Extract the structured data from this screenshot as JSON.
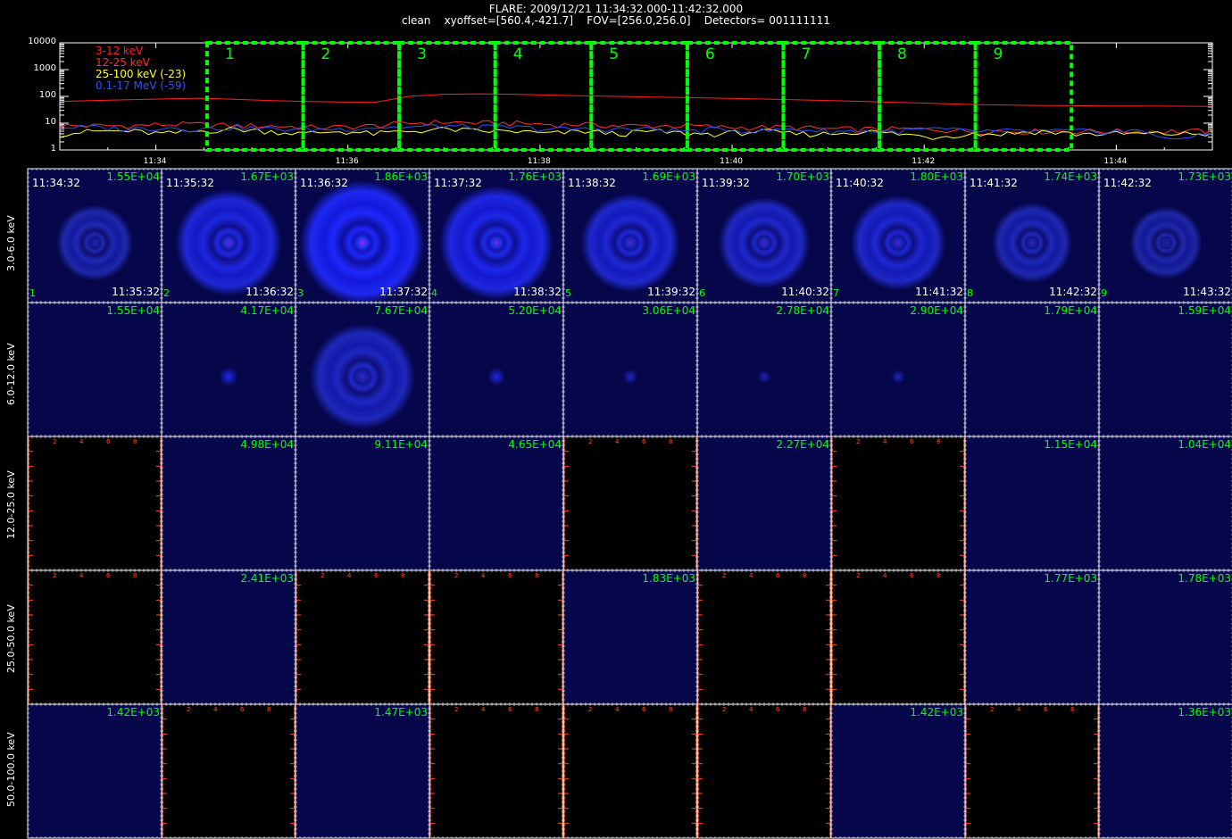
{
  "header": {
    "title_line1": "FLARE: 2009/12/21 11:34:32.000-11:42:32.000",
    "title_line2": "clean    xyoffset=[560.4,-421.7]    FOV=[256.0,256.0]    Detectors= 001111111"
  },
  "chart_data": [
    {
      "type": "line",
      "title": "",
      "yscale": "log",
      "ylim": [
        1,
        10000
      ],
      "y_tick_labels": [
        "1",
        "10",
        "100",
        "1000",
        "10000"
      ],
      "x_tick_labels": [
        "11:34",
        "11:36",
        "11:38",
        "11:40",
        "11:42",
        "11:44"
      ],
      "x_range": [
        "11:33",
        "11:45"
      ],
      "legend_placement": "top-left",
      "series": [
        {
          "name": "3-12 keV",
          "color": "#ff2020",
          "level_desc": "~60-120",
          "values": [
            65,
            70,
            75,
            80,
            85,
            78,
            70,
            65,
            62,
            60,
            100,
            120,
            125,
            120,
            112,
            105,
            100,
            95,
            90,
            85,
            80,
            75,
            70,
            65,
            60,
            55,
            50,
            48,
            46,
            45,
            44,
            44,
            43,
            42
          ]
        },
        {
          "name": "12-25 keV",
          "color": "#ff3030",
          "values": [
            8,
            8,
            8,
            9,
            9,
            8,
            8,
            7,
            7,
            8,
            10,
            11,
            10,
            10,
            9,
            9,
            8,
            8,
            8,
            7,
            7,
            7,
            6,
            6,
            6,
            6,
            5,
            5,
            5,
            5,
            5,
            5,
            5,
            5
          ]
        },
        {
          "name": "25-100 keV (-23)",
          "color": "#ffff30",
          "values": [
            4,
            5,
            5,
            4,
            5,
            6,
            5,
            4,
            5,
            4,
            5,
            6,
            5,
            5,
            4,
            5,
            4,
            5,
            4,
            4,
            5,
            4,
            4,
            5,
            4,
            3,
            4,
            4,
            5,
            4,
            4,
            4,
            4,
            4
          ]
        },
        {
          "name": "0.1-17 MeV (-59)",
          "color": "#3050ff",
          "values": [
            7,
            7,
            6,
            7,
            6,
            7,
            6,
            6,
            6,
            7,
            7,
            8,
            7,
            7,
            6,
            6,
            6,
            6,
            5,
            6,
            5,
            6,
            5,
            5,
            5,
            6,
            5,
            5,
            5,
            5,
            5,
            5,
            2,
            5
          ]
        }
      ],
      "interval_boxes": [
        "1",
        "2",
        "3",
        "4",
        "5",
        "6",
        "7",
        "8",
        "9"
      ]
    },
    {
      "type": "heatmap",
      "rows": [
        "3.0-6.0 keV",
        "6.0-12.0 keV",
        "12.0-25.0 keV",
        "25.0-50.0 keV",
        "50.0-100.0 keV"
      ],
      "columns": [
        {
          "index": "1",
          "start": "11:34:32",
          "end": "11:35:32"
        },
        {
          "index": "2",
          "start": "11:35:32",
          "end": "11:36:32"
        },
        {
          "index": "3",
          "start": "11:36:32",
          "end": "11:37:32"
        },
        {
          "index": "4",
          "start": "11:37:32",
          "end": "11:38:32"
        },
        {
          "index": "5",
          "start": "11:38:32",
          "end": "11:39:32"
        },
        {
          "index": "6",
          "start": "11:39:32",
          "end": "11:40:32"
        },
        {
          "index": "7",
          "start": "11:40:32",
          "end": "11:41:32"
        },
        {
          "index": "8",
          "start": "11:41:32",
          "end": "11:42:32"
        },
        {
          "index": "9",
          "start": "11:42:32",
          "end": "11:43:32"
        }
      ],
      "panels": [
        [
          {
            "max": "1.55E+04",
            "kind": "ring",
            "intensity": 0.35
          },
          {
            "max": "1.67E+03",
            "kind": "ring",
            "intensity": 0.75
          },
          {
            "max": "1.86E+03",
            "kind": "ring",
            "intensity": 1.0
          },
          {
            "max": "1.76E+03",
            "kind": "ring",
            "intensity": 0.85
          },
          {
            "max": "1.69E+03",
            "kind": "ring",
            "intensity": 0.65
          },
          {
            "max": "1.70E+03",
            "kind": "ring",
            "intensity": 0.55
          },
          {
            "max": "1.80E+03",
            "kind": "ring",
            "intensity": 0.6
          },
          {
            "max": "1.74E+03",
            "kind": "ring",
            "intensity": 0.4
          },
          {
            "max": "1.73E+03",
            "kind": "ring",
            "intensity": 0.3
          }
        ],
        [
          {
            "max": "1.55E+04",
            "kind": "flat"
          },
          {
            "max": "4.17E+04",
            "kind": "dot",
            "intensity": 0.8
          },
          {
            "max": "7.67E+04",
            "kind": "ring",
            "intensity": 0.5
          },
          {
            "max": "5.20E+04",
            "kind": "dot",
            "intensity": 0.7
          },
          {
            "max": "3.06E+04",
            "kind": "dot",
            "intensity": 0.4
          },
          {
            "max": "2.78E+04",
            "kind": "dot",
            "intensity": 0.25
          },
          {
            "max": "2.90E+04",
            "kind": "dot",
            "intensity": 0.3
          },
          {
            "max": "1.79E+04",
            "kind": "flat"
          },
          {
            "max": "1.59E+04",
            "kind": "flat"
          }
        ],
        [
          {
            "max": "",
            "kind": "empty"
          },
          {
            "max": "4.98E+04",
            "kind": "flat"
          },
          {
            "max": "9.11E+04",
            "kind": "flat"
          },
          {
            "max": "4.65E+04",
            "kind": "flat"
          },
          {
            "max": "",
            "kind": "empty"
          },
          {
            "max": "2.27E+04",
            "kind": "flat"
          },
          {
            "max": "",
            "kind": "empty"
          },
          {
            "max": "1.15E+04",
            "kind": "flat"
          },
          {
            "max": "1.04E+04",
            "kind": "flat"
          }
        ],
        [
          {
            "max": "",
            "kind": "empty"
          },
          {
            "max": "2.41E+03",
            "kind": "flat"
          },
          {
            "max": "",
            "kind": "empty"
          },
          {
            "max": "",
            "kind": "empty"
          },
          {
            "max": "1.83E+03",
            "kind": "flat"
          },
          {
            "max": "",
            "kind": "empty"
          },
          {
            "max": "",
            "kind": "empty"
          },
          {
            "max": "1.77E+03",
            "kind": "flat"
          },
          {
            "max": "1.78E+03",
            "kind": "flat"
          }
        ],
        [
          {
            "max": "1.42E+03",
            "kind": "flat"
          },
          {
            "max": "",
            "kind": "empty"
          },
          {
            "max": "1.47E+03",
            "kind": "flat"
          },
          {
            "max": "",
            "kind": "empty"
          },
          {
            "max": "",
            "kind": "empty"
          },
          {
            "max": "",
            "kind": "empty"
          },
          {
            "max": "1.42E+03",
            "kind": "flat"
          },
          {
            "max": "",
            "kind": "empty"
          },
          {
            "max": "1.36E+03",
            "kind": "flat"
          }
        ]
      ],
      "empty_axis_ticks": [
        "2",
        "4",
        "6",
        "8"
      ]
    }
  ],
  "colors": {
    "background": "#000000",
    "panel_fill": "#06064a",
    "panel_border": "#ffffff",
    "empty_axis": "#ff5020",
    "max_label": "#00ff00",
    "box_outline": "#00ff00"
  }
}
